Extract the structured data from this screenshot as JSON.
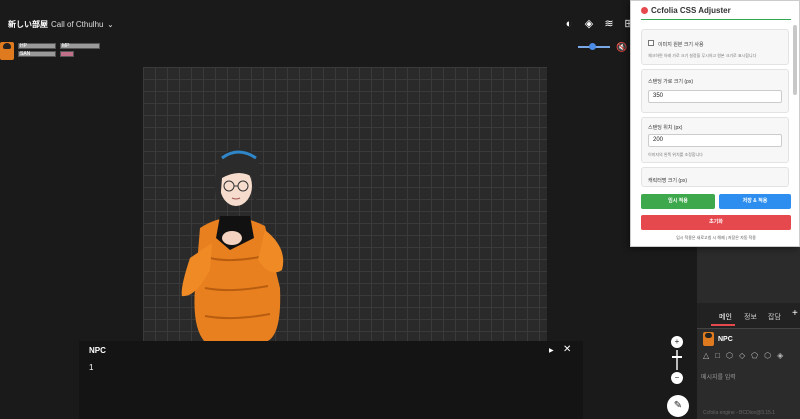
{
  "room": {
    "title": "新しい部屋",
    "system": "Call of Cthulhu"
  },
  "status": {
    "hp_label": "HP",
    "mp_label": "MP",
    "san_label": "SAN"
  },
  "npc_window": {
    "title": "NPC",
    "text": "1"
  },
  "side": {
    "tabs": [
      "메인",
      "정보",
      "잡담"
    ],
    "npc_name": "NPC",
    "message_placeholder": "메시지를 입력",
    "version": "Ccfolia engine - BCDice@3.15.1"
  },
  "popup": {
    "title": "Ccfolia CSS Adjuster",
    "use_original_label": "이미지 원본 크기 사용",
    "use_original_hint": "체크하면 아래 가로 크기 설정을 무시하고 원본 크기로 표시합니다",
    "width_label": "스탠딩 가로 크기 (px)",
    "width_value": "350",
    "pos_label": "스탠딩 위치 (px)",
    "pos_value": "200",
    "pos_hint": "이미지의 왼쪽 위치를 조정합니다",
    "char_size_label": "캐릭터명 크기 (px)",
    "btn_preview": "임시 적용",
    "btn_save": "저장 & 적용",
    "btn_reset": "초기화",
    "note": "임시 적용은 새로고침 시 해제 | 저장은 자동 적용"
  },
  "colors": {
    "accent_red": "#e5484d",
    "green": "#3ea84c",
    "blue": "#2d8ef0"
  },
  "volume": {
    "level": 0.45
  }
}
